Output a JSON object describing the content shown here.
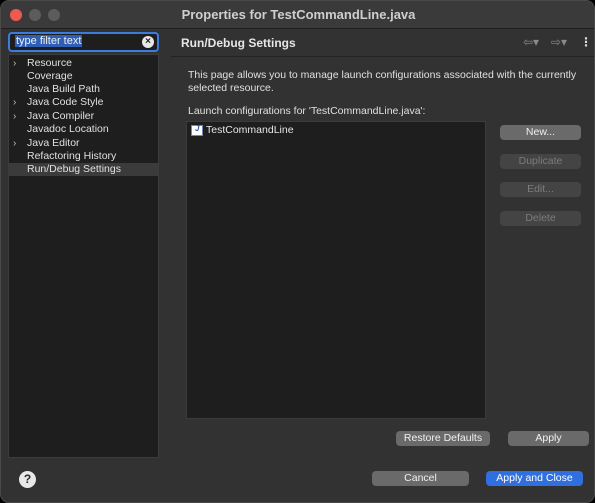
{
  "window": {
    "title": "Properties for TestCommandLine.java"
  },
  "filter": {
    "value": "type filter text",
    "clear_icon": "clear-icon"
  },
  "tree": {
    "items": [
      {
        "label": "Resource",
        "expandable": true
      },
      {
        "label": "Coverage",
        "expandable": false
      },
      {
        "label": "Java Build Path",
        "expandable": false
      },
      {
        "label": "Java Code Style",
        "expandable": true
      },
      {
        "label": "Java Compiler",
        "expandable": true
      },
      {
        "label": "Javadoc Location",
        "expandable": false
      },
      {
        "label": "Java Editor",
        "expandable": true
      },
      {
        "label": "Refactoring History",
        "expandable": false
      },
      {
        "label": "Run/Debug Settings",
        "expandable": false,
        "selected": true
      }
    ]
  },
  "page": {
    "title": "Run/Debug Settings",
    "description": "This page allows you to manage launch configurations associated with the currently selected resource.",
    "list_label": "Launch configurations for 'TestCommandLine.java':",
    "configurations": [
      "TestCommandLine"
    ],
    "buttons": {
      "new": "New...",
      "duplicate": "Duplicate",
      "edit": "Edit...",
      "delete": "Delete"
    },
    "restore_defaults": "Restore Defaults",
    "apply": "Apply"
  },
  "footer": {
    "help": "?",
    "cancel": "Cancel",
    "apply_and_close": "Apply and Close"
  },
  "colors": {
    "accent": "#2f6fe0",
    "close_traffic_light": "#ee5a52"
  }
}
